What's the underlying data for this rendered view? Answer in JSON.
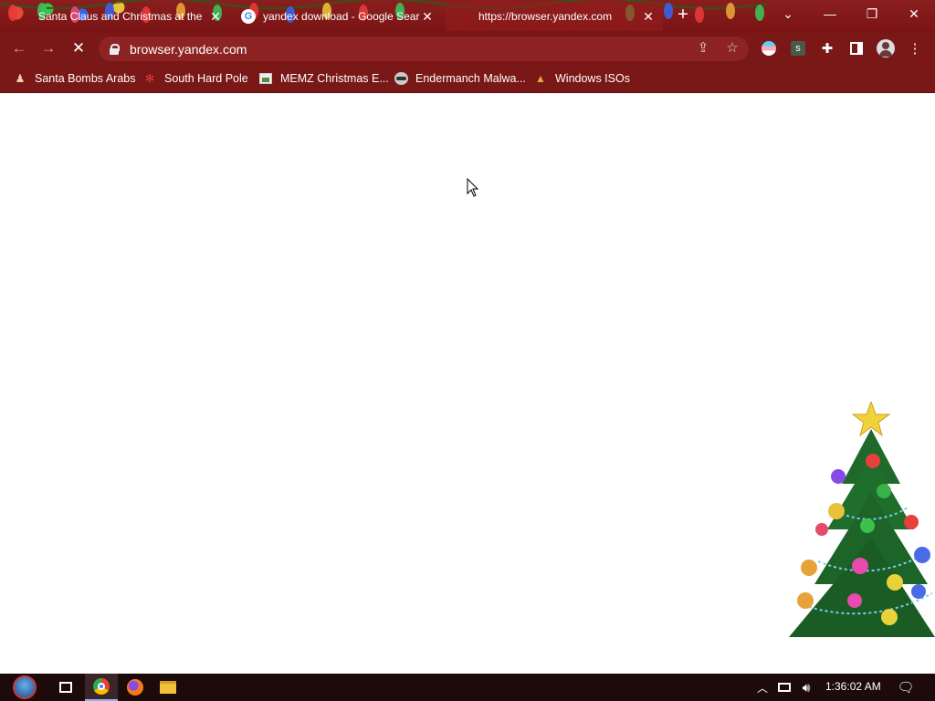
{
  "tabs": [
    {
      "title": "Santa Claus and Christmas at the",
      "favicon": "santa-icon",
      "active": false
    },
    {
      "title": "yandex download - Google Searc",
      "favicon": "google-icon",
      "active": false
    },
    {
      "title": "https://browser.yandex.com",
      "favicon": "none",
      "active": true
    }
  ],
  "toolbar": {
    "url": "browser.yandex.com",
    "back_icon": "back-arrow-icon",
    "forward_icon": "forward-arrow-icon",
    "stop_icon": "stop-loading-icon"
  },
  "bookmarks": [
    {
      "label": "Santa Bombs Arabs",
      "icon": "santa-icon"
    },
    {
      "label": "South Hard Pole",
      "icon": "snowflake-icon"
    },
    {
      "label": "MEMZ Christmas E...",
      "icon": "image-icon"
    },
    {
      "label": "Endermanch Malwa...",
      "icon": "raccoon-icon"
    },
    {
      "label": "Windows ISOs",
      "icon": "tree-icon"
    }
  ],
  "taskbar": {
    "clock": "1:36:02 AM"
  },
  "colors": {
    "frame": "#7a1717",
    "omnibox": "#8d2323",
    "taskbar": "#1d0b0b"
  }
}
